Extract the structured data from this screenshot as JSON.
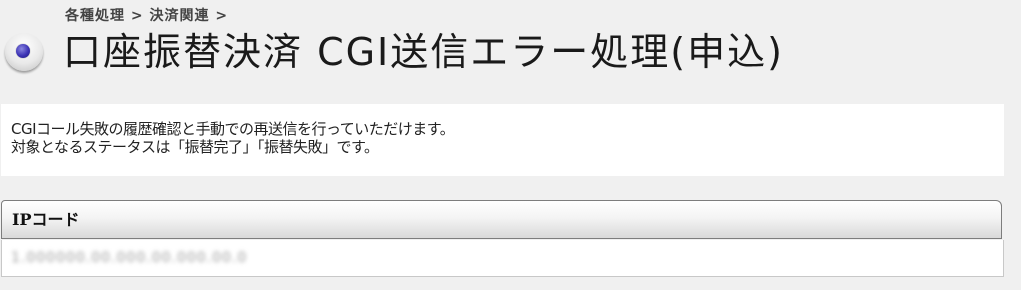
{
  "header": {
    "breadcrumb": "各種処理 > 決済関連 >",
    "title": "口座振替決済 CGI送信エラー処理(申込)",
    "bullet_icon": "radio-bullet-icon"
  },
  "description": {
    "line1": "CGIコール失敗の履歴確認と手動での再送信を行っていただけます。",
    "line2": "対象となるステータスは「振替完了」「振替失敗」です。"
  },
  "ip_table": {
    "header_label": "IPコード",
    "value": "1.000000.00.000.00.000.00.0"
  },
  "colors": {
    "background": "#f0f0f0",
    "panel": "#ffffff",
    "bullet_accent": "#3c33b5"
  }
}
